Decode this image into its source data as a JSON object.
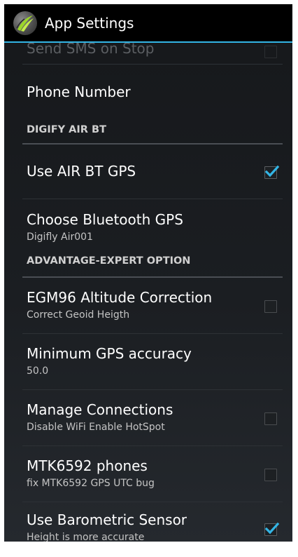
{
  "app": {
    "title": "App Settings"
  },
  "preferences": {
    "send_sms": {
      "title": "Send SMS on Stop",
      "checked": false
    },
    "phone_number": {
      "title": "Phone Number"
    },
    "category_airbt": "DIGIFY AIR BT",
    "use_airbt_gps": {
      "title": "Use AIR BT GPS",
      "checked": true
    },
    "choose_bt_gps": {
      "title": "Choose Bluetooth GPS",
      "summary": "Digifly Air001"
    },
    "category_advantage": "ADVANTAGE-EXPERT OPTION",
    "egm96": {
      "title": "EGM96 Altitude Correction",
      "summary": "Correct Geoid Heigth",
      "checked": false
    },
    "min_gps_accuracy": {
      "title": "Minimum GPS accuracy",
      "summary": "50.0"
    },
    "manage_connections": {
      "title": "Manage Connections",
      "summary": "Disable WiFi Enable HotSpot",
      "checked": false
    },
    "mtk6592": {
      "title": "MTK6592 phones",
      "summary": "fix MTK6592 GPS UTC bug",
      "checked": false
    },
    "barometric": {
      "title": "Use Barometric Sensor",
      "summary": "Height is more accurate",
      "checked": true
    }
  },
  "colors": {
    "accent": "#33b5e5",
    "background": "#1b1e22",
    "actionbar": "#000000"
  },
  "icons": {
    "app": "glider-logo-icon",
    "check": "check-mark-icon"
  }
}
